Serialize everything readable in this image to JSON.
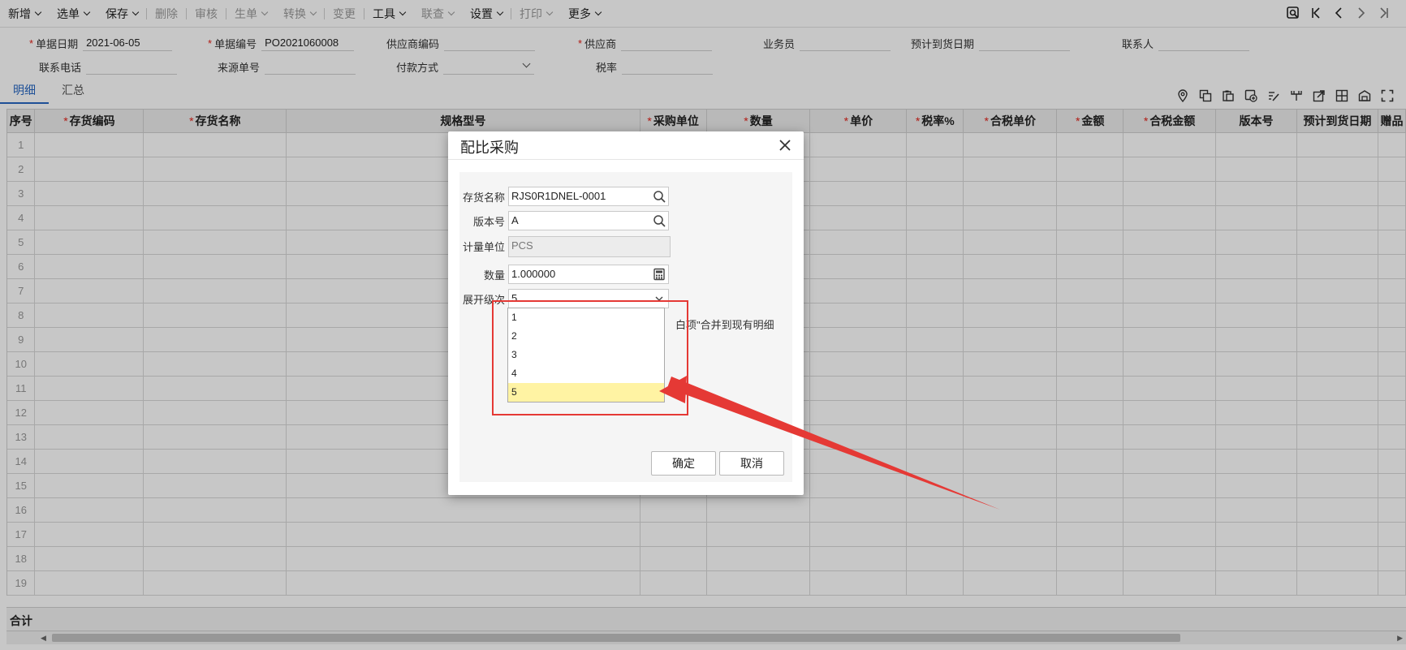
{
  "toolbar": {
    "items": [
      {
        "label": "新增",
        "dropdown": true,
        "disabled": false
      },
      {
        "label": "选单",
        "dropdown": true,
        "disabled": false
      },
      {
        "label": "保存",
        "dropdown": true,
        "disabled": false
      },
      {
        "label": "删除",
        "dropdown": false,
        "disabled": true
      },
      {
        "label": "审核",
        "dropdown": false,
        "disabled": true
      },
      {
        "label": "生单",
        "dropdown": true,
        "disabled": true
      },
      {
        "label": "转换",
        "dropdown": true,
        "disabled": true
      },
      {
        "label": "变更",
        "dropdown": false,
        "disabled": true
      },
      {
        "label": "工具",
        "dropdown": true,
        "disabled": false
      },
      {
        "label": "联查",
        "dropdown": true,
        "disabled": true
      },
      {
        "label": "设置",
        "dropdown": true,
        "disabled": false
      },
      {
        "label": "打印",
        "dropdown": true,
        "disabled": true
      },
      {
        "label": "更多",
        "dropdown": true,
        "disabled": false
      }
    ],
    "nav_icons": [
      "preview-search-icon",
      "first-record-icon",
      "prev-record-icon",
      "next-record-icon",
      "last-record-icon"
    ]
  },
  "header": {
    "doc_date": {
      "label": "单据日期",
      "value": "2021-06-05",
      "required": true
    },
    "doc_no": {
      "label": "单据编号",
      "value": "PO2021060008",
      "required": true
    },
    "supplier_code": {
      "label": "供应商编码",
      "value": ""
    },
    "supplier": {
      "label": "供应商",
      "value": "",
      "required": true
    },
    "salesman": {
      "label": "业务员",
      "value": ""
    },
    "expected_date": {
      "label": "预计到货日期",
      "value": ""
    },
    "contact": {
      "label": "联系人",
      "value": ""
    },
    "phone": {
      "label": "联系电话",
      "value": ""
    },
    "source_no": {
      "label": "来源单号",
      "value": ""
    },
    "payment": {
      "label": "付款方式",
      "value": ""
    },
    "tax_rate": {
      "label": "税率",
      "value": ""
    }
  },
  "tabs": [
    {
      "label": "明细",
      "active": true
    },
    {
      "label": "汇总",
      "active": false
    }
  ],
  "grid_icons": [
    "location-icon",
    "copy-row-icon",
    "paste-row-icon",
    "insert-row-icon",
    "edit-row-icon",
    "split-icon",
    "export-icon",
    "layout-icon",
    "warehouse-icon",
    "fullscreen-icon"
  ],
  "table": {
    "columns": [
      {
        "label": "序号",
        "required": false
      },
      {
        "label": "存货编码",
        "required": true
      },
      {
        "label": "存货名称",
        "required": true
      },
      {
        "label": "规格型号",
        "required": false
      },
      {
        "label": "采购单位",
        "required": true
      },
      {
        "label": "数量",
        "required": true
      },
      {
        "label": "单价",
        "required": true
      },
      {
        "label": "税率%",
        "required": true
      },
      {
        "label": "合税单价",
        "required": true
      },
      {
        "label": "金额",
        "required": true
      },
      {
        "label": "合税金额",
        "required": true
      },
      {
        "label": "版本号",
        "required": false
      },
      {
        "label": "预计到货日期",
        "required": false
      },
      {
        "label": "赠品",
        "required": false
      }
    ],
    "rows": [
      "1",
      "2",
      "3",
      "4",
      "5",
      "6",
      "7",
      "8",
      "9",
      "10",
      "11",
      "12",
      "13",
      "14",
      "15",
      "16",
      "17",
      "18",
      "19"
    ],
    "total_label": "合计"
  },
  "dialog": {
    "title": "配比采购",
    "fields": {
      "item_name": {
        "label": "存货名称",
        "value": "RJS0R1DNEL-0001"
      },
      "version": {
        "label": "版本号",
        "value": "A"
      },
      "unit": {
        "label": "计量单位",
        "value": "PCS"
      },
      "quantity": {
        "label": "数量",
        "value": "1.000000"
      },
      "expand_level": {
        "label": "展开级次",
        "value": "5"
      }
    },
    "merge_text": "白项\"合并到现有明细",
    "ok_label": "确定",
    "cancel_label": "取消"
  },
  "dropdown": {
    "options": [
      "1",
      "2",
      "3",
      "4",
      "5"
    ],
    "selected": "5"
  },
  "annotation": {
    "color": "#e53935"
  }
}
